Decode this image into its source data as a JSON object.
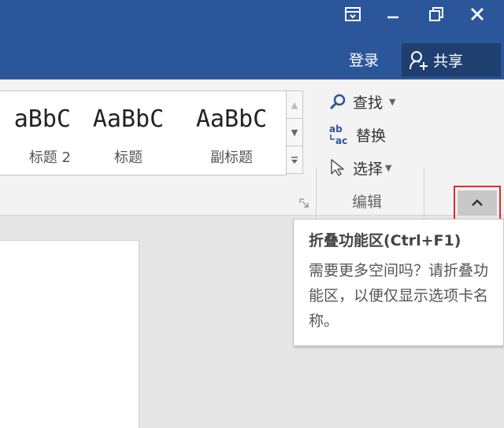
{
  "titlebar": {
    "login_label": "登录",
    "share_label": "共享",
    "accent_color": "#2b579a"
  },
  "styles_gallery": {
    "items": [
      {
        "sample": "aBbC",
        "name": "标题 2"
      },
      {
        "sample": "AaBbC",
        "name": "标题"
      },
      {
        "sample": "AaBbC",
        "name": "副标题"
      }
    ]
  },
  "editing_group": {
    "find_label": "查找",
    "replace_label": "替换",
    "select_label": "选择",
    "group_label": "编辑"
  },
  "tooltip": {
    "title": "折叠功能区(Ctrl+F1)",
    "body": "需要更多空间吗？请折叠功能区，以便仅显示选项卡名称。"
  }
}
